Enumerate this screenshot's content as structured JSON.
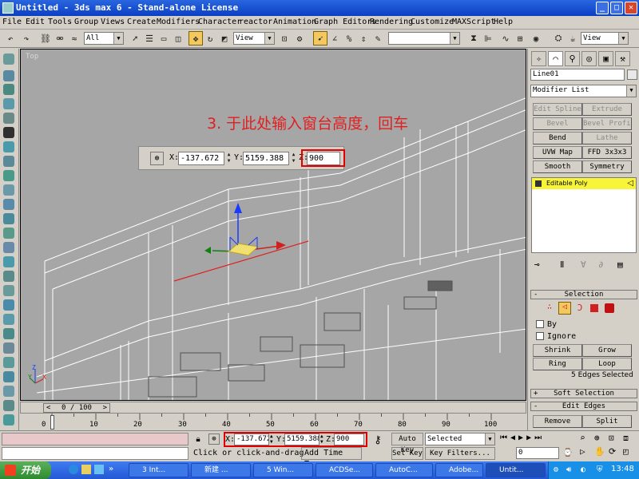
{
  "window": {
    "title": "Untitled - 3ds max 6 - Stand-alone License",
    "buttons": [
      "_",
      "□",
      "✕"
    ]
  },
  "menu": [
    "File",
    "Edit",
    "Tools",
    "Group",
    "Views",
    "Create",
    "Modifiers",
    "Character",
    "reactor",
    "Animation",
    "Graph Editors",
    "Rendering",
    "Customize",
    "MAXScript",
    "Help"
  ],
  "toolbar": {
    "selection_filter": "All",
    "ref_coord": "View",
    "named_selection": "",
    "ref_coord2": "View"
  },
  "viewport": {
    "label": "Top",
    "instruction": "3. 于此处输入窗台高度，回车"
  },
  "transform_dialog": {
    "x": "-137.672",
    "y": "5159.388",
    "z": "900"
  },
  "command_panel": {
    "object_name": "Line01",
    "modifier_list": "Modifier List",
    "modifier_buttons": [
      {
        "label": "Edit Spline",
        "enabled": false
      },
      {
        "label": "Extrude",
        "enabled": false
      },
      {
        "label": "Bevel",
        "enabled": false
      },
      {
        "label": "Bevel Profile",
        "enabled": false
      },
      {
        "label": "Bend",
        "enabled": true
      },
      {
        "label": "Lathe",
        "enabled": false
      },
      {
        "label": "UVW Map",
        "enabled": true
      },
      {
        "label": "FFD 3x3x3",
        "enabled": true
      },
      {
        "label": "Smooth",
        "enabled": true
      },
      {
        "label": "Symmetry",
        "enabled": true
      }
    ],
    "stack_item": "Editable Poly",
    "selection": {
      "header": "Selection",
      "by": "By",
      "ignore": "Ignore",
      "buttons": [
        "Shrink",
        "Grow",
        "Ring",
        "Loop"
      ],
      "status": "5 Edges Selected"
    },
    "soft_selection": "Soft Selection",
    "edit_edges": {
      "header": "Edit Edges",
      "buttons": [
        "Remove",
        "Split"
      ]
    }
  },
  "timeslider": {
    "label": "0 / 100",
    "current": 0,
    "total": 100
  },
  "track_ticks": [
    "0",
    "10",
    "20",
    "30",
    "40",
    "50",
    "60",
    "70",
    "80",
    "90",
    "100"
  ],
  "status": {
    "x": "-137.672",
    "y": "5159.388",
    "z": "900",
    "prompt": "Click or click-and-drag",
    "add_time_tag": "Add Time Tag",
    "auto_key": "Auto Key",
    "set_key": "Set Key",
    "selected": "Selected",
    "key_filters": "Key Filters...",
    "frame": "0"
  },
  "taskbar": {
    "start": "开始",
    "tasks": [
      "3 Int...",
      "新建 ...",
      "5 Win...",
      "ACDSe...",
      "AutoC...",
      "Adobe...",
      "Untit..."
    ],
    "clock": "13:48"
  }
}
